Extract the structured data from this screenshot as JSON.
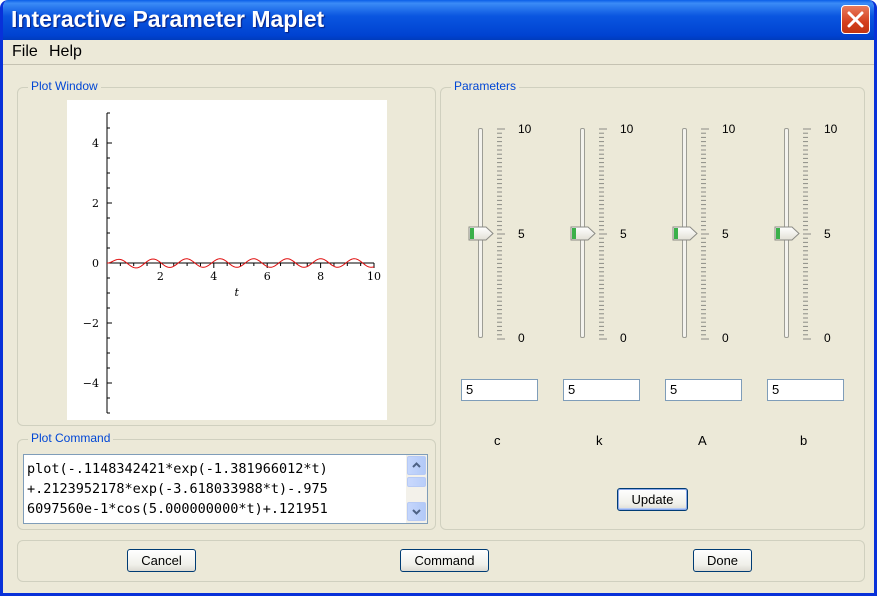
{
  "window": {
    "title": "Interactive Parameter Maplet"
  },
  "menu": {
    "items": [
      "File",
      "Help"
    ]
  },
  "plot_window": {
    "label": "Plot Window",
    "chart_data": {
      "type": "line",
      "xlabel": "t",
      "ylabel": "",
      "xlim": [
        0,
        10
      ],
      "ylim": [
        -5,
        5
      ],
      "x_ticks": [
        "2",
        "4",
        "6",
        "8",
        "10"
      ],
      "y_ticks": [
        "4",
        "2",
        "0",
        "−2",
        "−4"
      ],
      "series": [
        {
          "color": "#e01010",
          "function": "A*sin(5t)-like oscillation, amplitude ~0.12",
          "x": [
            0,
            0.3,
            0.6,
            0.9,
            1.2,
            1.6,
            1.9,
            2.2,
            2.5,
            2.8,
            3.1,
            3.5,
            3.8,
            4.1,
            4.4,
            4.7,
            5.0,
            5.3,
            5.7,
            6.0,
            6.3,
            6.6,
            6.9,
            7.2,
            7.5,
            7.9,
            8.2,
            8.5,
            8.8,
            9.1,
            9.4,
            9.7,
            10
          ],
          "y": [
            0,
            0.12,
            0.02,
            -0.12,
            -0.05,
            0.12,
            0.03,
            -0.12,
            -0.04,
            0.12,
            0.02,
            -0.12,
            -0.04,
            0.12,
            0.03,
            -0.12,
            -0.03,
            0.12,
            0.02,
            -0.12,
            -0.04,
            0.12,
            0.03,
            -0.12,
            -0.03,
            0.12,
            0.02,
            -0.12,
            -0.04,
            0.12,
            0.03,
            -0.12,
            0
          ]
        }
      ]
    }
  },
  "plot_command": {
    "label": "Plot Command",
    "lines": [
      "plot(-.1148342421*exp(-1.381966012*t)",
      "+.2123952178*exp(-3.618033988*t)-.975",
      "6097560e-1*cos(5.000000000*t)+.121951"
    ]
  },
  "parameters": {
    "label": "Parameters",
    "sliders": [
      {
        "name": "c",
        "value": 5,
        "min": "0",
        "mid": "5",
        "max": "10",
        "field_value": "5"
      },
      {
        "name": "k",
        "value": 5,
        "min": "0",
        "mid": "5",
        "max": "10",
        "field_value": "5"
      },
      {
        "name": "A",
        "value": 5,
        "min": "0",
        "mid": "5",
        "max": "10",
        "field_value": "5"
      },
      {
        "name": "b",
        "value": 5,
        "min": "0",
        "mid": "5",
        "max": "10",
        "field_value": "5"
      }
    ],
    "update_label": "Update"
  },
  "footer": {
    "cancel_label": "Cancel",
    "command_label": "Command",
    "done_label": "Done"
  }
}
